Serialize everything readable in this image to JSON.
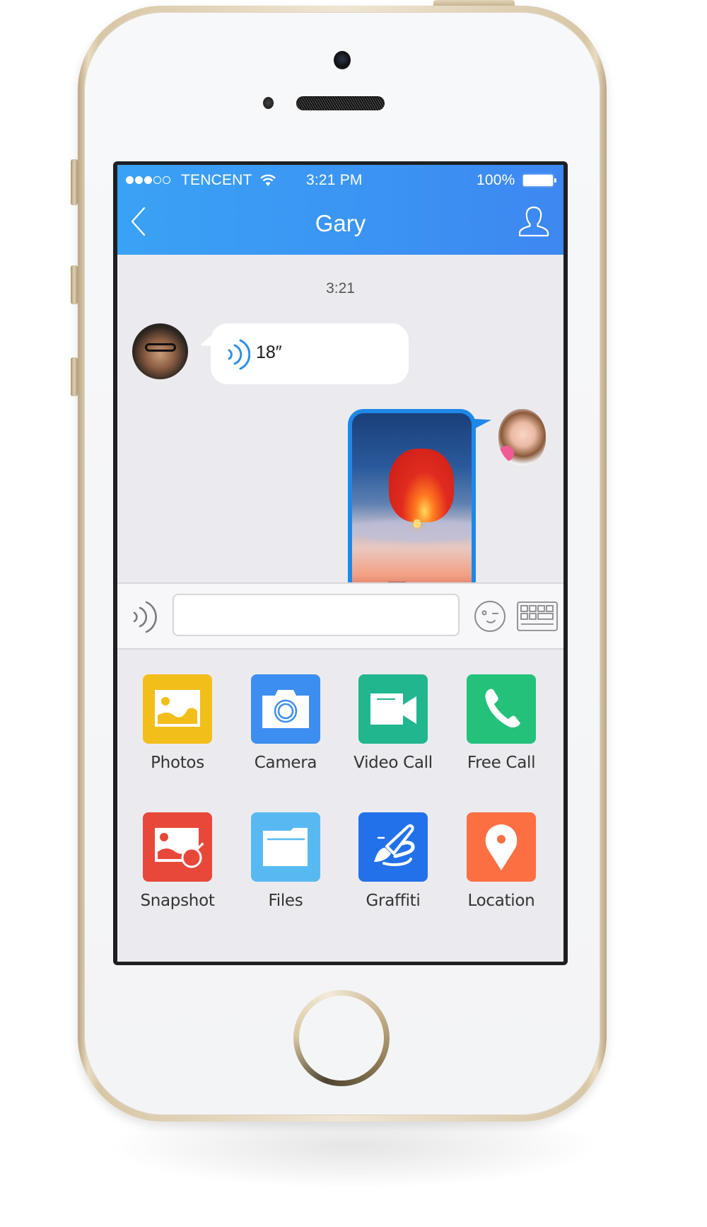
{
  "status_bar": {
    "signal_bars_filled": 3,
    "signal_bars_total": 5,
    "carrier": "TENCENT",
    "wifi_icon": "wifi-icon",
    "time": "3:21 PM",
    "battery_percent": "100%",
    "battery_level": 1.0
  },
  "header": {
    "title": "Gary",
    "back_icon": "chevron-left-icon",
    "profile_icon": "user-profile-icon"
  },
  "chat": {
    "timestamp": "3:21",
    "messages": [
      {
        "sender": "Gary",
        "side": "left",
        "type": "voice",
        "duration": "18″",
        "icon": "voice-wave-icon"
      },
      {
        "sender": "me",
        "side": "right",
        "type": "image",
        "description": "sky lantern at dusk"
      }
    ]
  },
  "input_bar": {
    "voice_toggle_icon": "voice-wave-icon",
    "message_value": "",
    "message_placeholder": "",
    "emoji_icon": "emoji-wink-icon",
    "keyboard_icon": "keyboard-icon"
  },
  "apps": [
    {
      "label": "Photos",
      "icon": "photo-icon",
      "color": "#f2be1a"
    },
    {
      "label": "Camera",
      "icon": "camera-icon",
      "color": "#3c8ef0"
    },
    {
      "label": "Video Call",
      "icon": "video-camera-icon",
      "color": "#22b68f"
    },
    {
      "label": "Free Call",
      "icon": "phone-icon",
      "color": "#24c17b"
    },
    {
      "label": "Snapshot",
      "icon": "snapshot-bomb-icon",
      "color": "#e8483a"
    },
    {
      "label": "Files",
      "icon": "folder-icon",
      "color": "#58b9f2"
    },
    {
      "label": "Graffiti",
      "icon": "paintbrush-icon",
      "color": "#2271ea"
    },
    {
      "label": "Location",
      "icon": "location-pin-icon",
      "color": "#fb6f43"
    }
  ],
  "colors": {
    "header_blue": "#3b93f3",
    "chat_background": "#ebebef",
    "image_bubble_border": "#1e88e8"
  }
}
